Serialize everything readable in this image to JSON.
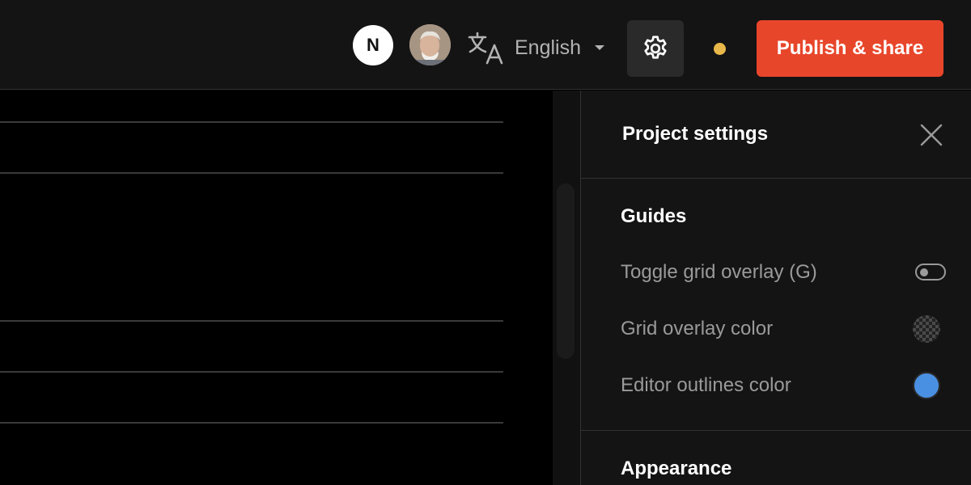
{
  "header": {
    "user_initial": "N",
    "language": {
      "label": "English",
      "icon": "translate-icon"
    },
    "settings_icon": "gear-icon",
    "status_color": "#e8b84a",
    "publish_label": "Publish & share",
    "publish_color": "#e8462b"
  },
  "panel": {
    "title": "Project settings",
    "close_icon": "close-icon",
    "sections": {
      "guides": {
        "title": "Guides",
        "toggle_grid_label": "Toggle grid overlay (G)",
        "toggle_grid_on": false,
        "grid_color_label": "Grid overlay color",
        "grid_color": "transparent",
        "outline_color_label": "Editor outlines color",
        "outline_color": "#4a90e2"
      },
      "appearance": {
        "title": "Appearance"
      }
    }
  }
}
